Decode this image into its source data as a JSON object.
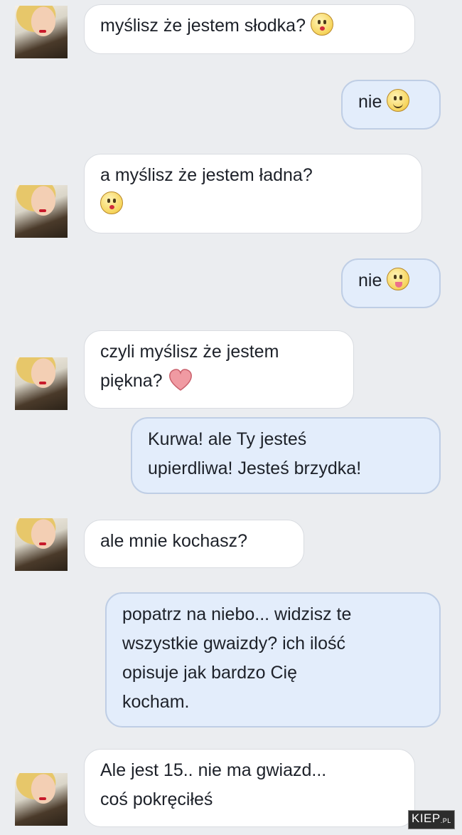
{
  "conversation": {
    "messages": [
      {
        "from": "her",
        "text": "myślisz że jestem słodka?",
        "emoji": "kiss-icon"
      },
      {
        "from": "me",
        "text": "nie",
        "emoji": "smile-icon"
      },
      {
        "from": "her",
        "text": "a myślisz że jestem ładna?",
        "emoji": "kiss-icon"
      },
      {
        "from": "me",
        "text": "nie",
        "emoji": "tongue-icon"
      },
      {
        "from": "her",
        "text_line1": "czyli myślisz że jestem",
        "text_line2": "piękna?",
        "emoji": "heart-icon"
      },
      {
        "from": "me",
        "text_line1": "Kurwa! ale Ty jesteś",
        "text_line2": "upierdliwa! Jesteś brzydka!"
      },
      {
        "from": "her",
        "text": "ale mnie kochasz?"
      },
      {
        "from": "me",
        "text_line1": "popatrz na niebo... widzisz te",
        "text_line2": "wszystkie gwaizdy? ich ilość",
        "text_line3": "opisuje jak bardzo Cię",
        "text_line4": "kocham."
      },
      {
        "from": "her",
        "text_line1": "Ale jest 15.. nie ma gwiazd...",
        "text_line2": "coś pokręciłeś"
      }
    ]
  },
  "colors": {
    "incoming_bubble": "#ffffff",
    "outgoing_bubble": "#e3edfb",
    "background": "#ebedf0"
  },
  "watermark": {
    "text": "KIEP",
    "suffix": ".PL"
  }
}
